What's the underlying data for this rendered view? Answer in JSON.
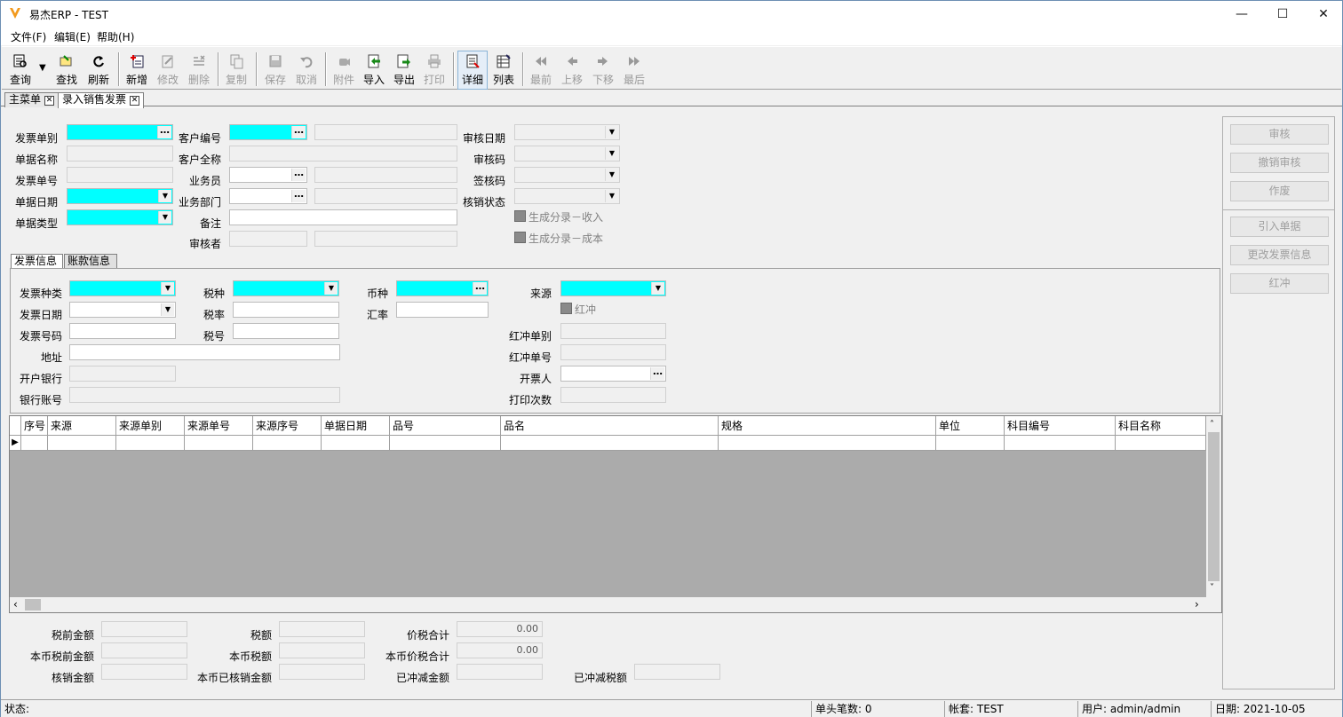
{
  "window": {
    "title": "易杰ERP - TEST",
    "minimize": "—",
    "maximize": "☐",
    "close": "✕"
  },
  "menu": [
    "文件(F)",
    "编辑(E)",
    "帮助(H)"
  ],
  "toolbar": {
    "query": "查询",
    "find": "查找",
    "refresh": "刷新",
    "add": "新增",
    "edit": "修改",
    "delete": "删除",
    "copy": "复制",
    "save": "保存",
    "cancel": "取消",
    "attach": "附件",
    "import": "导入",
    "export": "导出",
    "print": "打印",
    "detail": "详细",
    "list": "列表",
    "first": "最前",
    "up": "上移",
    "down": "下移",
    "last": "最后"
  },
  "tabs": [
    "主菜单",
    "录入销售发票"
  ],
  "header": {
    "col1": [
      "发票单别",
      "单据名称",
      "发票单号",
      "单据日期",
      "单据类型"
    ],
    "col2": [
      "客户编号",
      "客户全称",
      "业务员",
      "业务部门",
      "备注",
      "审核者"
    ],
    "col3": [
      "审核日期",
      "审核码",
      "签核码",
      "核销状态"
    ],
    "chk1": "生成分录－收入",
    "chk2": "生成分录－成本"
  },
  "side_buttons": [
    "审核",
    "撤销审核",
    "作废",
    "引入单据",
    "更改发票信息",
    "红冲"
  ],
  "inner_tabs": [
    "发票信息",
    "账款信息"
  ],
  "invoice": {
    "c1": [
      "发票种类",
      "发票日期",
      "发票号码",
      "地址",
      "开户银行",
      "银行账号"
    ],
    "c2": [
      "税种",
      "税率",
      "税号"
    ],
    "c3": [
      "币种",
      "汇率"
    ],
    "c4a": "来源",
    "red_chk": "红冲",
    "c4": [
      "红冲单别",
      "红冲单号",
      "开票人",
      "打印次数"
    ]
  },
  "grid": {
    "columns": [
      "序号",
      "来源",
      "来源单别",
      "来源单号",
      "来源序号",
      "单据日期",
      "品号",
      "品名",
      "规格",
      "单位",
      "科目编号",
      "科目名称"
    ],
    "row_marker": "▶"
  },
  "footer": {
    "c1": [
      "税前金额",
      "本币税前金额",
      "核销金额"
    ],
    "c2": [
      "税额",
      "本币税额",
      "本币已核销金额"
    ],
    "c3": [
      "价税合计",
      "本币价税合计",
      "已冲减金额"
    ],
    "c3_values": [
      "0.00",
      "0.00",
      ""
    ],
    "c4": "已冲减税额"
  },
  "status": {
    "state": "状态:",
    "count": "单头笔数: 0",
    "account": "帐套: TEST",
    "user": "用户: admin/admin",
    "date": "日期: 2021-10-05"
  },
  "colors": {
    "required": "#00ffff",
    "window_bg": "#f0f0f0"
  }
}
